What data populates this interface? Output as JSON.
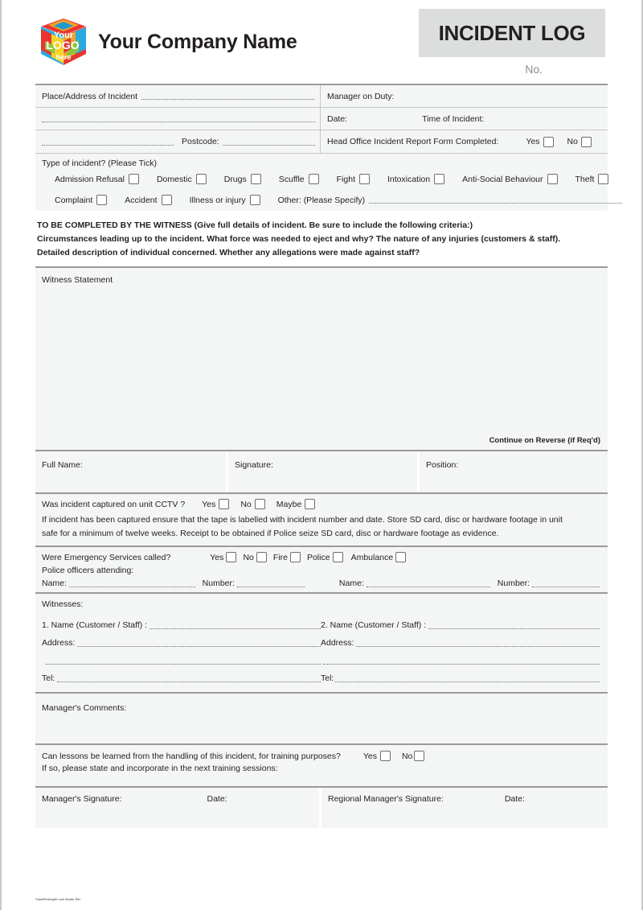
{
  "header": {
    "logo_alt": "Your LOGO here",
    "logo_lines": [
      "Your",
      "LOGO",
      "here"
    ],
    "company_name": "Your Company Name",
    "title": "INCIDENT LOG",
    "number_label": "No.",
    "title_bg": "#dcdedd",
    "no_color": "#8d8d8d"
  },
  "info": {
    "place_label": "Place/Address of Incident",
    "postcode_label": "Postcode:",
    "manager_on_duty_label": "Manager on Duty:",
    "date_label": "Date:",
    "time_of_incident_label": "Time of Incident:",
    "head_office_label": "Head Office Incident Report Form Completed:",
    "yes_label": "Yes",
    "no_label": "No"
  },
  "incident_type": {
    "heading": "Type of incident? (Please Tick)",
    "row1": [
      "Admission Refusal",
      "Domestic",
      "Drugs",
      "Scuffle",
      "Fight",
      "Intoxication",
      "Anti-Social Behaviour",
      "Theft"
    ],
    "row2": [
      "Complaint",
      "Accident",
      "Illness or injury"
    ],
    "other_label": "Other: (Please Specify)"
  },
  "instructions": [
    "TO BE COMPLETED BY THE WITNESS (Give full details of incident. Be sure to include the following criteria:)",
    "Circumstances leading up to the incident. What force was needed to eject and why? The nature of any injuries (customers & staff).",
    "Detailed description of individual concerned. Whether any allegations were made against staff?"
  ],
  "statement": {
    "label": "Witness Statement",
    "continue_note": "Continue on Reverse (if Req'd)"
  },
  "identity": {
    "full_name_label": "Full Name:",
    "signature_label": "Signature:",
    "position_label": "Position:"
  },
  "cctv": {
    "question": "Was incident captured on unit CCTV ?",
    "options": [
      "Yes",
      "No",
      "Maybe"
    ],
    "body_line1": "If incident has been captured ensure that the tape is labelled with incident number and date. Store SD card, disc or hardware footage in unit",
    "body_line2": "safe for a minimum of twelve weeks. Receipt to be obtained if Police seize SD card, disc or hardware footage as evidence."
  },
  "emergency": {
    "question": "Were Emergency Services called?",
    "options": [
      "Yes",
      "No",
      "Fire",
      "Police",
      "Ambulance"
    ],
    "officers_label": "Police officers attending:",
    "name_label": "Name:",
    "number_label": "Number:"
  },
  "witnesses": {
    "heading": "Witnesses:",
    "entry1_label": "1. Name (Customer / Staff) :",
    "entry2_label": "2. Name (Customer / Staff) :",
    "address_label": "Address:",
    "tel_label": "Tel:"
  },
  "manager_comments": {
    "label": "Manager's Comments:"
  },
  "lessons": {
    "question": "Can lessons be learned from the handling of this incident, for training purposes?",
    "yes_label": "Yes",
    "no_label": "No",
    "followup": "If so, please state and incorporate in the next training sessions:"
  },
  "signatures": {
    "manager_signature_label": "Manager's Signature:",
    "manager_date_label": "Date:",
    "regional_signature_label": "Regional Manager's Signature:",
    "regional_date_label": "Date:"
  },
  "footer": {
    "note": "TradePrintingUK.com Border Ref:"
  }
}
